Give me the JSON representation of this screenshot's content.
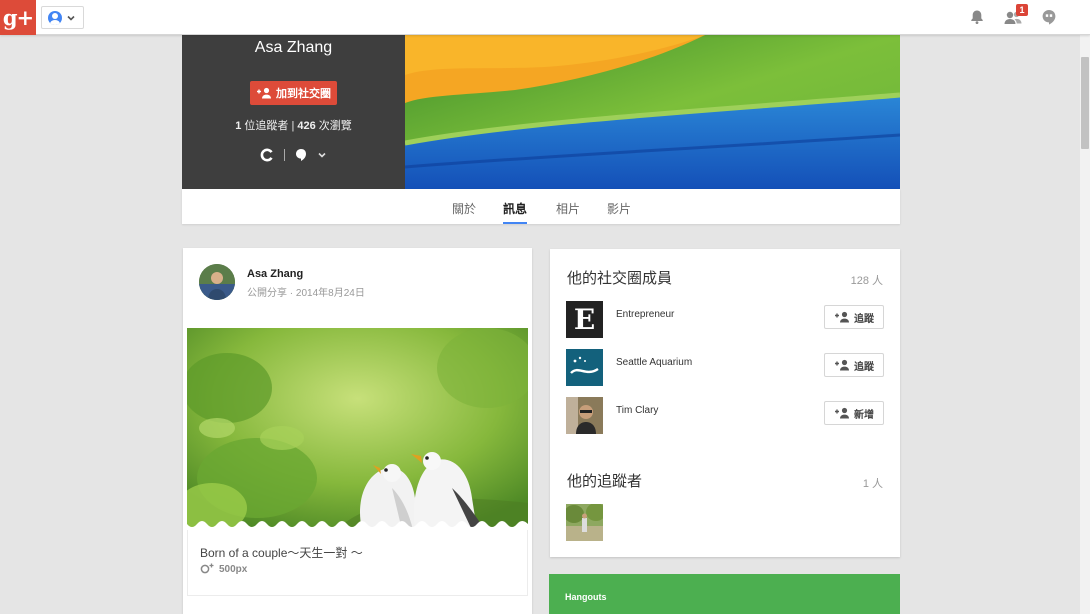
{
  "topbar": {
    "logo_text": "g+",
    "notifications_count": "1",
    "icons": [
      "bell-icon",
      "people-icon",
      "hangouts-icon"
    ]
  },
  "profile": {
    "name": "Asa Zhang",
    "join_label": "加到社交圈",
    "followers_count": "1",
    "followers_text": "位追蹤者",
    "separator": "|",
    "views_count": "426",
    "views_text": "次瀏覽"
  },
  "tabs": [
    {
      "label": "關於",
      "active": false
    },
    {
      "label": "訊息",
      "active": true
    },
    {
      "label": "相片",
      "active": false
    },
    {
      "label": "影片",
      "active": false
    }
  ],
  "post": {
    "author": "Asa Zhang",
    "visibility": "公開分享",
    "dot": "·",
    "date": "2014年8月24日",
    "caption": "Born of a couple～天生一對 ～",
    "source": "500px"
  },
  "circles": {
    "title": "他的社交圈成員",
    "count": "128 人",
    "members": [
      {
        "name": "Entrepreneur",
        "action": "追蹤",
        "thumb_letter": "E"
      },
      {
        "name": "Seattle Aquarium",
        "action": "追蹤"
      },
      {
        "name": "Tim Clary",
        "action": "新增"
      }
    ]
  },
  "followers": {
    "title": "他的追蹤者",
    "count": "1 人"
  },
  "hangouts": {
    "title": "Hangouts"
  },
  "colors": {
    "brand_red": "#dd4b39",
    "tab_active_underline": "#4285f4",
    "hangouts_green": "#4caf50",
    "profile_panel": "#3e3e3e"
  }
}
